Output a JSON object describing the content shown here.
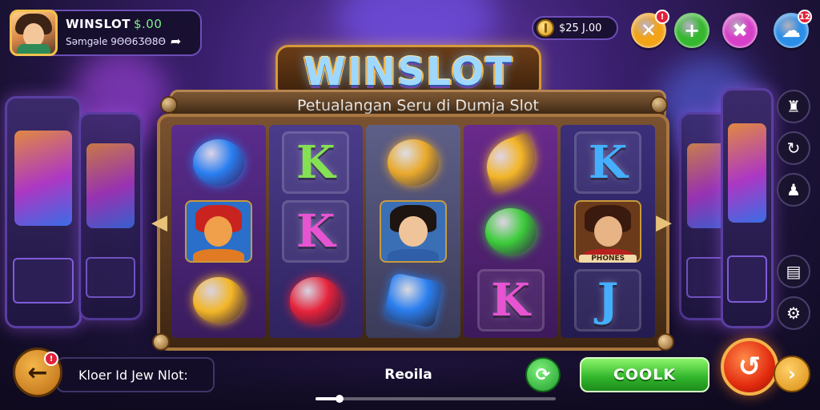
{
  "profile": {
    "name": "WINSLOT",
    "balance": "$.00",
    "subline": "Səmgəlе 9ΘΘ6ƷΘ8Θ",
    "arrow_icon": "arrow-right-icon"
  },
  "top_bar": {
    "coins": "$25 J.00",
    "coin_icon": "coin-icon",
    "buttons": [
      {
        "name": "close-bonus-button",
        "glyph": "✕",
        "color": "#f2a316",
        "badge": "!"
      },
      {
        "name": "add-button",
        "glyph": "+",
        "color": "#36b82e"
      },
      {
        "name": "tools-button",
        "glyph": "✖",
        "color": "#d640c8"
      },
      {
        "name": "chat-button",
        "glyph": "☁",
        "color": "#2a8ee8",
        "badge": "12"
      }
    ]
  },
  "side_icons": [
    "trophy-icon",
    "refresh-icon",
    "user-icon",
    "document-icon",
    "settings-icon"
  ],
  "title": {
    "main": "WINSLOT",
    "subtitle": "Petualangan Seru di Dumja Slot"
  },
  "reels": [
    [
      {
        "type": "icon",
        "name": "candy-bubble",
        "color": "#2a7ef0"
      },
      {
        "type": "portrait",
        "name": "fox-character",
        "bg": "#2a6fc9",
        "hair": "#c9231f",
        "face": "#f0a04a",
        "body": "#e07b24"
      },
      {
        "type": "icon",
        "name": "gold-bird",
        "color": "#f2b526"
      }
    ],
    [
      {
        "type": "letter",
        "letter": "K",
        "color": "#7ee04a"
      },
      {
        "type": "letter",
        "letter": "K",
        "color": "#e64ad0"
      },
      {
        "type": "icon",
        "name": "red-heart",
        "color": "#e6223a"
      }
    ],
    [
      {
        "type": "icon",
        "name": "gold-ornament",
        "color": "#e8a82a"
      },
      {
        "type": "portrait",
        "name": "woman-character",
        "bg": "#3a6fb5",
        "hair": "#1e1410",
        "face": "#f0c49a",
        "body": "#2f5fa8"
      },
      {
        "type": "icon",
        "name": "blue-gem",
        "color": "#2a7ef0"
      }
    ],
    [
      {
        "type": "icon",
        "name": "gold-leaf",
        "color": "#f2b526"
      },
      {
        "type": "icon",
        "name": "green-chameleon",
        "color": "#3ccc3a"
      },
      {
        "type": "letter",
        "letter": "K",
        "color": "#e64ad0"
      }
    ],
    [
      {
        "type": "letter",
        "letter": "K",
        "color": "#39a9ff"
      },
      {
        "type": "portrait",
        "name": "man-character",
        "bg": "#6a3a1a",
        "hair": "#3a1a0e",
        "face": "#e8b486",
        "body": "#b82020",
        "label": "PHONES"
      },
      {
        "type": "letter",
        "letter": "J",
        "color": "#39a9ff"
      }
    ]
  ],
  "bottom_bar": {
    "back_icon": "back-arrow-icon",
    "back_badge": "!",
    "input_text": "Kloer Id Jew Nlot:",
    "center_label": "Reoila",
    "refresh_icon": "refresh-icon",
    "cook_label": "COOLK",
    "spin_icon": "spin-icon",
    "next_icon": "chevron-right-icon",
    "progress": 0.1
  }
}
